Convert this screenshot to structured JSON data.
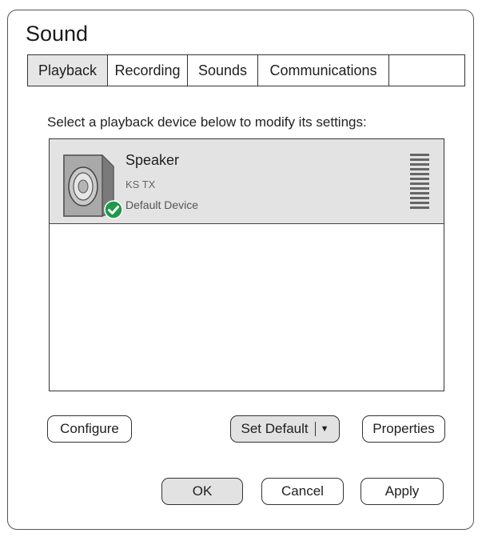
{
  "window": {
    "title": "Sound"
  },
  "tabs": [
    {
      "label": "Playback",
      "active": true
    },
    {
      "label": "Recording",
      "active": false
    },
    {
      "label": "Sounds",
      "active": false
    },
    {
      "label": "Communications",
      "active": false
    }
  ],
  "playback": {
    "instruction": "Select a playback device below to modify its settings:",
    "devices": [
      {
        "name": "Speaker",
        "subtitle": "KS TX",
        "status": "Default Device",
        "icon": "speaker-icon",
        "badge_icon": "default-check-icon",
        "selected": true
      }
    ]
  },
  "buttons": {
    "configure": "Configure",
    "set_default": "Set Default",
    "set_default_caret": "▼",
    "properties": "Properties",
    "ok": "OK",
    "cancel": "Cancel",
    "apply": "Apply"
  },
  "colors": {
    "check_badge": "#1f9a4a",
    "selected_row": "#e3e3e3"
  }
}
